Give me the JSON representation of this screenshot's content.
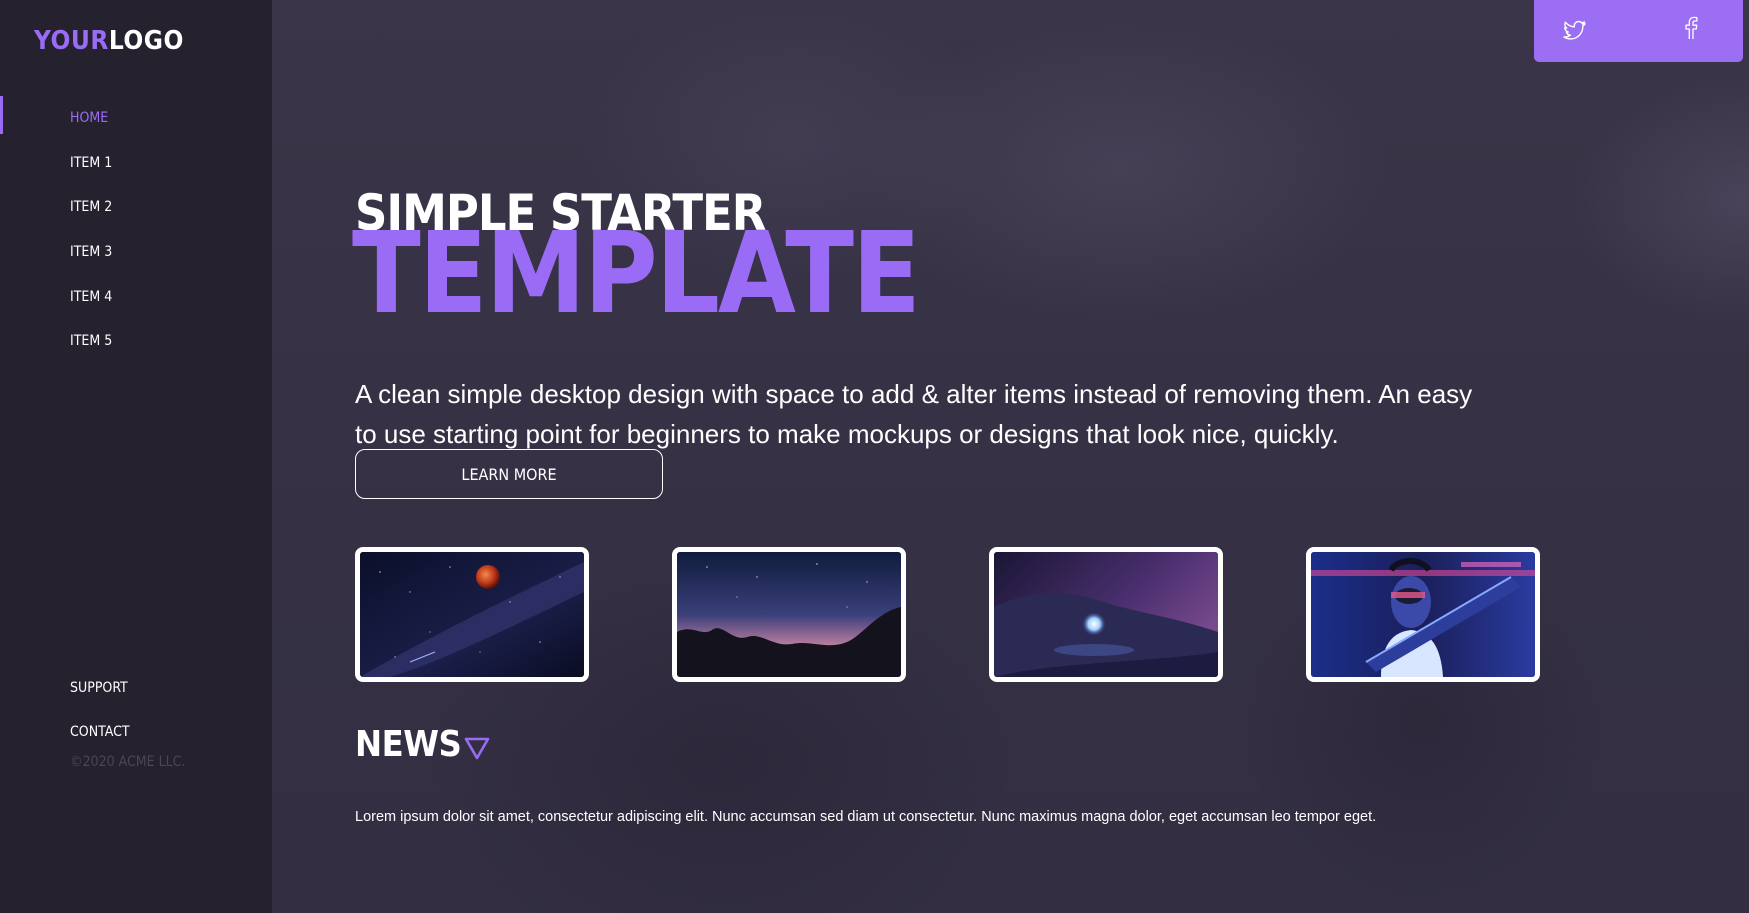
{
  "brand": {
    "logo_part1": "YOUR",
    "logo_part2": "LOGO",
    "accent_color": "#9a6cf5"
  },
  "sidebar": {
    "items": [
      {
        "label": "HOME",
        "active": true
      },
      {
        "label": "ITEM 1"
      },
      {
        "label": "ITEM 2"
      },
      {
        "label": "ITEM 3"
      },
      {
        "label": "ITEM 4"
      },
      {
        "label": "ITEM 5"
      }
    ],
    "bottom_links": [
      {
        "label": "SUPPORT"
      },
      {
        "label": "CONTACT"
      }
    ],
    "copyright": "©2020 ACME LLC."
  },
  "social": {
    "icons": [
      "twitter-icon",
      "facebook-icon"
    ]
  },
  "hero": {
    "title_line1": "SIMPLE STARTER",
    "title_line2": "TEMPLATE",
    "description": "A clean simple desktop design with space to add & alter items instead of removing them. An easy to use starting point for beginners to make mockups or designs that look nice, quickly.",
    "cta_label": "LEARN MORE"
  },
  "gallery": {
    "images": [
      {
        "subject": "blood moon over milky way"
      },
      {
        "subject": "starry sky over rock formations"
      },
      {
        "subject": "light orb in snowy night landscape"
      },
      {
        "subject": "neon portrait with instrument"
      }
    ]
  },
  "news": {
    "heading": "NEWS",
    "body": "Lorem ipsum dolor sit amet, consectetur adipiscing elit. Nunc accumsan sed diam ut consectetur. Nunc maximus magna dolor, eget accumsan leo tempor eget."
  }
}
